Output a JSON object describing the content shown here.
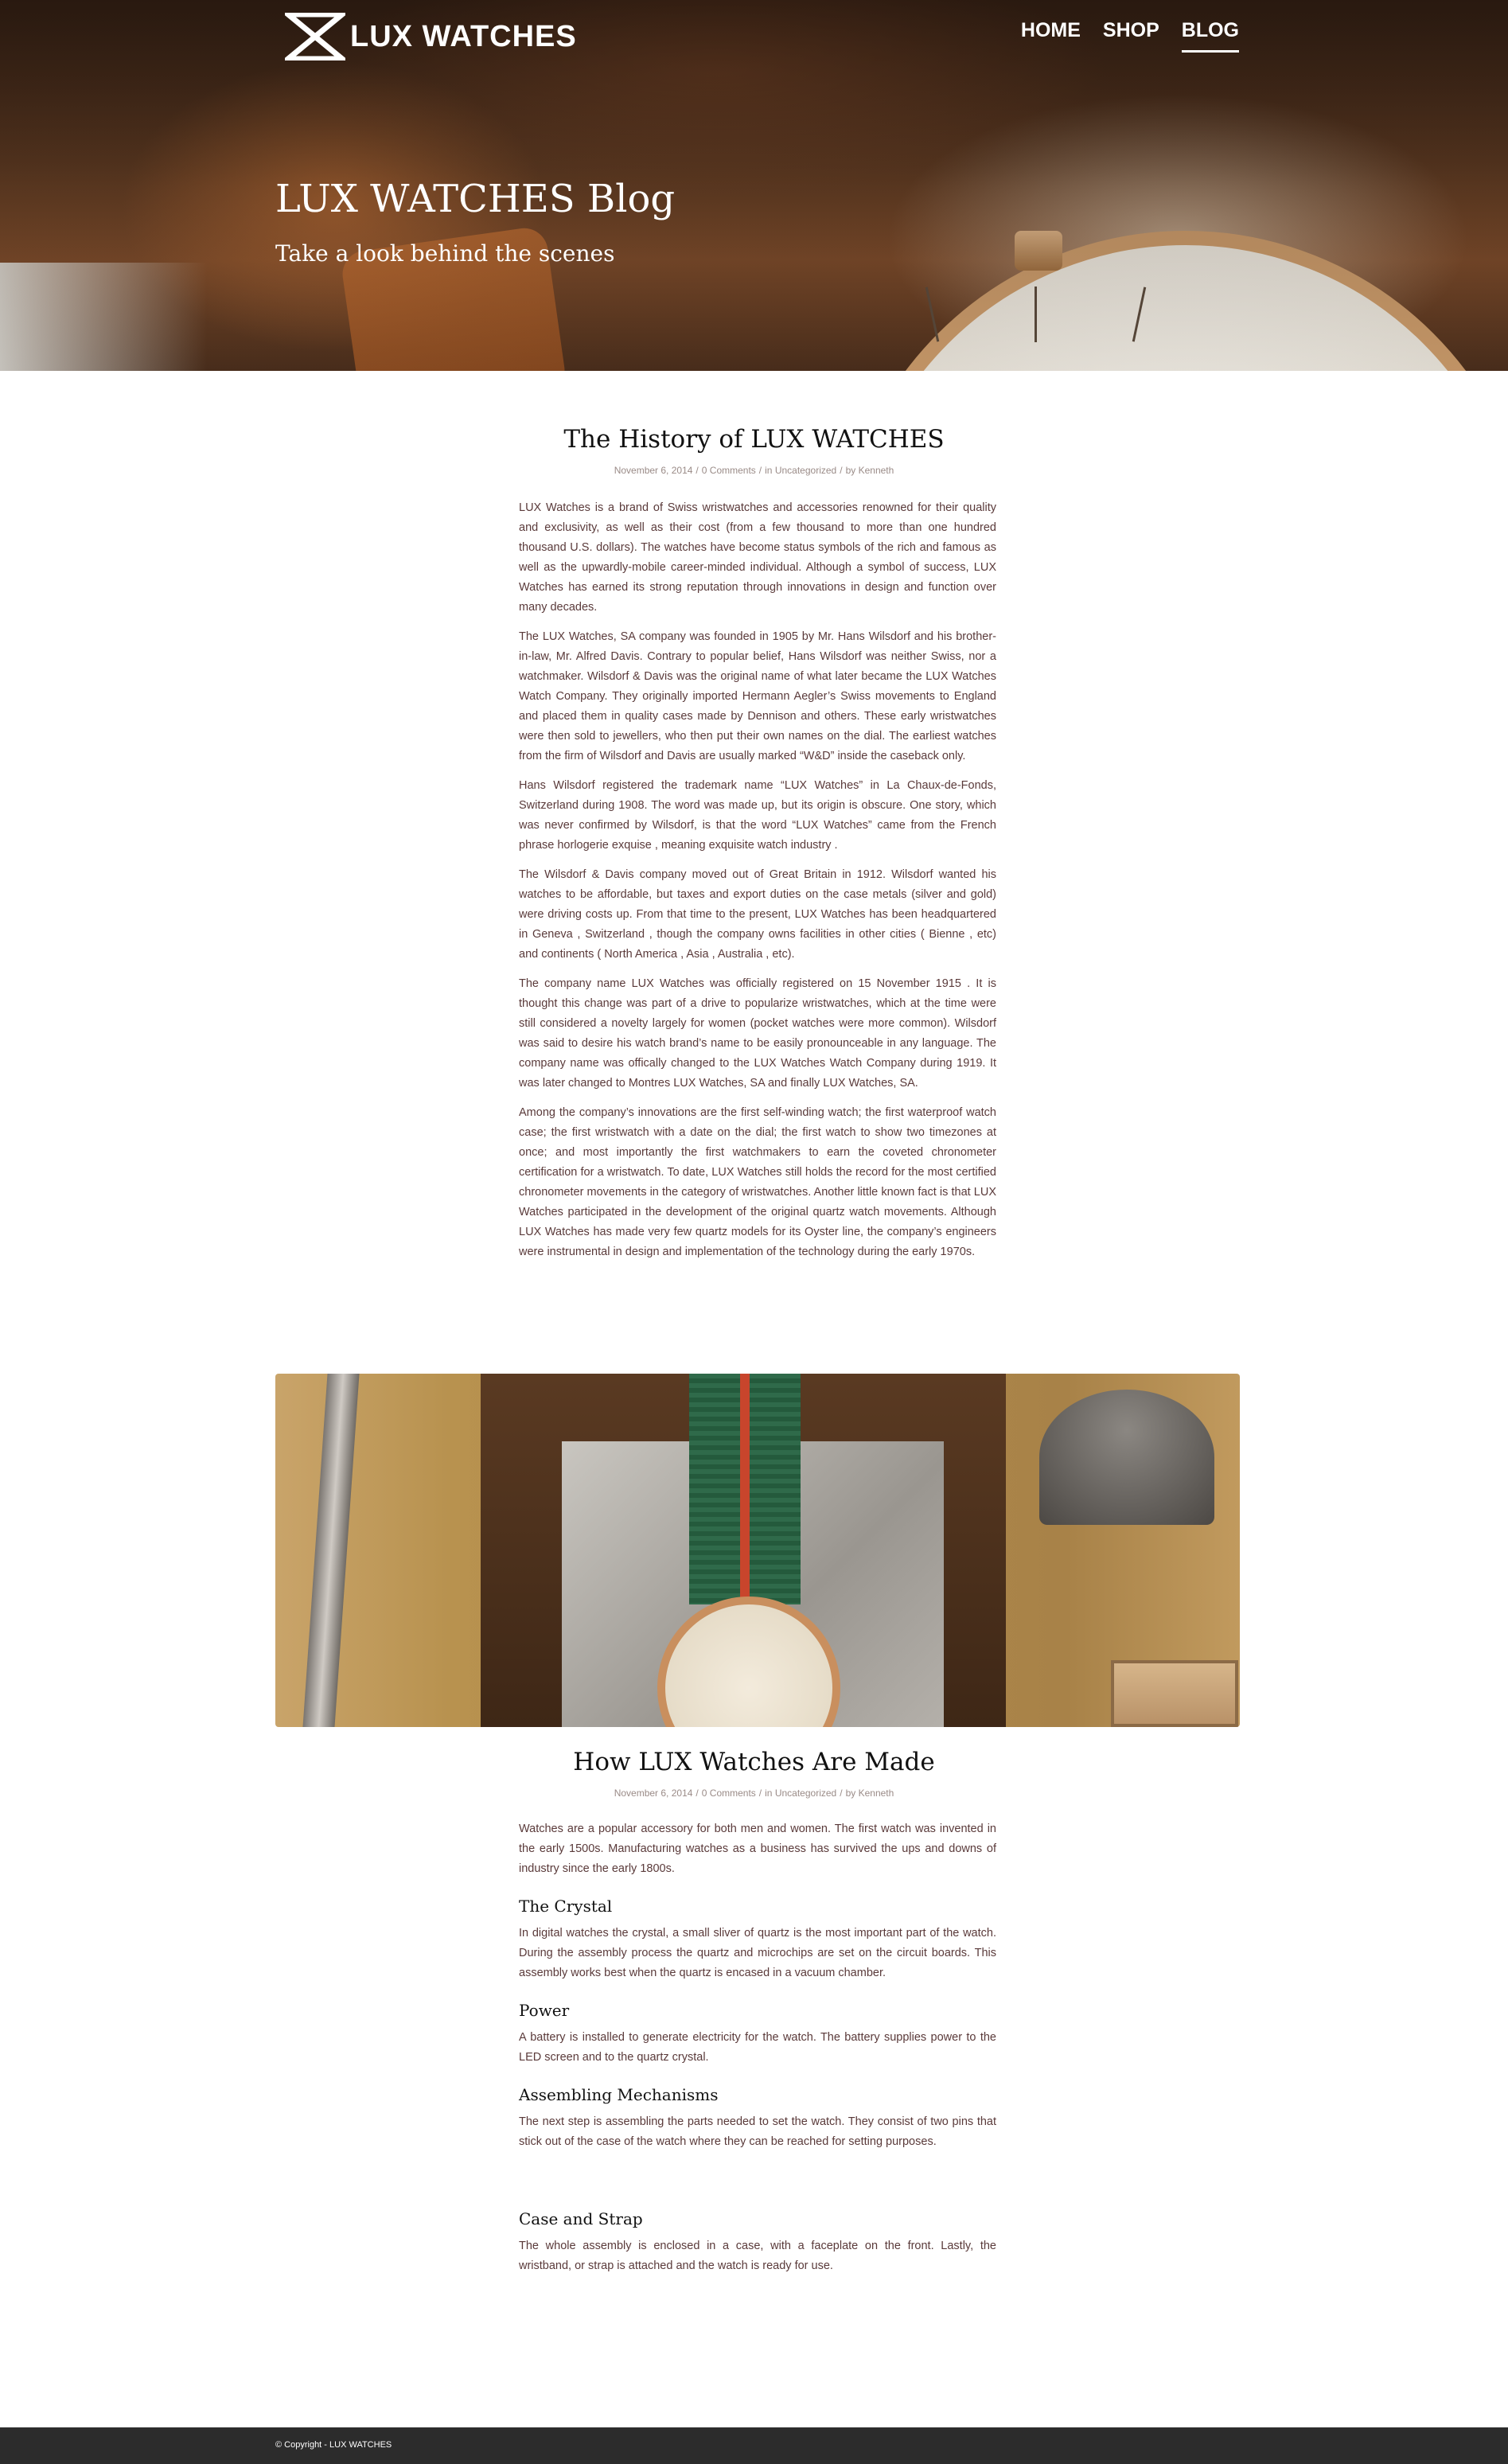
{
  "header": {
    "logo_text": "LUX WATCHES",
    "nav": [
      {
        "label": "HOME"
      },
      {
        "label": "SHOP"
      },
      {
        "label": "BLOG"
      }
    ],
    "active_nav": "BLOG"
  },
  "hero": {
    "title": "LUX WATCHES Blog",
    "subtitle": "Take a look behind the scenes"
  },
  "posts": [
    {
      "title": "The History of LUX WATCHES",
      "meta": {
        "date": "November 6, 2014",
        "comments": "0 Comments",
        "category_prefix": "in",
        "category": "Uncategorized",
        "author_prefix": "by",
        "author": "Kenneth"
      },
      "paragraphs": [
        "LUX Watches is a brand of Swiss wristwatches and accessories renowned for their quality and exclusivity, as well as their cost (from a few thousand to more than one hundred thousand U.S. dollars). The watches have become status symbols of the rich and famous as well as the upwardly-mobile career-minded individual. Although a symbol of success, LUX Watches has earned its strong reputation through innovations in design and function over many decades.",
        "The LUX Watches, SA company was founded in 1905 by Mr. Hans Wilsdorf and his brother-in-law, Mr. Alfred Davis. Contrary to popular belief, Hans Wilsdorf was neither Swiss, nor a watchmaker. Wilsdorf & Davis was the original name of what later became the LUX Watches Watch Company. They originally imported Hermann Aegler’s Swiss movements to England and placed them in quality cases made by Dennison and others. These early wristwatches were then sold to jewellers, who then put their own names on the dial. The earliest watches from the firm of Wilsdorf and Davis are usually marked “W&D” inside the caseback only.",
        "Hans Wilsdorf registered the trademark name “LUX Watches” in La Chaux-de-Fonds, Switzerland during 1908. The word was made up, but its origin is obscure. One story, which was never confirmed by Wilsdorf, is that the word “LUX Watches” came from the French phrase horlogerie exquise , meaning exquisite watch industry .",
        "The Wilsdorf & Davis company moved out of Great Britain in 1912. Wilsdorf wanted his watches to be affordable, but taxes and export duties on the case metals (silver and gold) were driving costs up. From that time to the present, LUX Watches has been headquartered in Geneva , Switzerland , though the company owns facilities in other cities ( Bienne , etc) and continents ( North America , Asia , Australia , etc).",
        "The company name LUX Watches was officially registered on 15 November 1915 . It is thought this change was part of a drive to popularize wristwatches, which at the time were still considered a novelty largely for women (pocket watches were more common). Wilsdorf was said to desire his watch brand’s name to be easily pronounceable in any language. The company name was offically changed to the LUX Watches Watch Company during 1919. It was later changed to Montres LUX Watches, SA and finally LUX Watches, SA.",
        "Among the company’s innovations are the first self-winding watch; the first waterproof watch case; the first wristwatch with a date on the dial; the first watch to show two timezones at once; and most importantly the first watchmakers to earn the coveted chronometer certification for a wristwatch. To date, LUX Watches still holds the record for the most certified chronometer movements in the category of wristwatches. Another little known fact is that LUX Watches participated in the development of the original quartz watch movements. Although LUX Watches has made very few quartz models for its Oyster line, the company’s engineers were instrumental in design and implementation of the technology during the early 1970s."
      ]
    },
    {
      "title": "How LUX Watches Are Made",
      "meta": {
        "date": "November 6, 2014",
        "comments": "0 Comments",
        "category_prefix": "in",
        "category": "Uncategorized",
        "author_prefix": "by",
        "author": "Kenneth"
      },
      "intro": "Watches are a popular accessory for both men and women. The first watch was invented in the early 1500s. Manufacturing watches as a business has survived the ups and downs of industry since the early 1800s.",
      "sections": [
        {
          "heading": "The Crystal",
          "text": "In digital watches the crystal, a small sliver of quartz is the most important part of the watch. During the assembly process the quartz and microchips are set on the circuit boards. This assembly works best when the quartz is encased in a vacuum chamber."
        },
        {
          "heading": "Power",
          "text": "A battery is installed to generate electricity for the watch. The battery supplies power to the LED screen and to the quartz crystal."
        },
        {
          "heading": "Assembling Mechanisms",
          "text": "The next step is assembling the parts needed to set the watch. They consist of two pins that stick out of the case of the watch where they can be reached for setting purposes."
        },
        {
          "heading": "Case and Strap",
          "text": "The whole assembly is enclosed in a case, with a faceplate on the front. Lastly, the wristband, or strap is attached and the watch is ready for use."
        }
      ]
    }
  ],
  "footer": {
    "copyright": "© Copyright - LUX WATCHES"
  }
}
